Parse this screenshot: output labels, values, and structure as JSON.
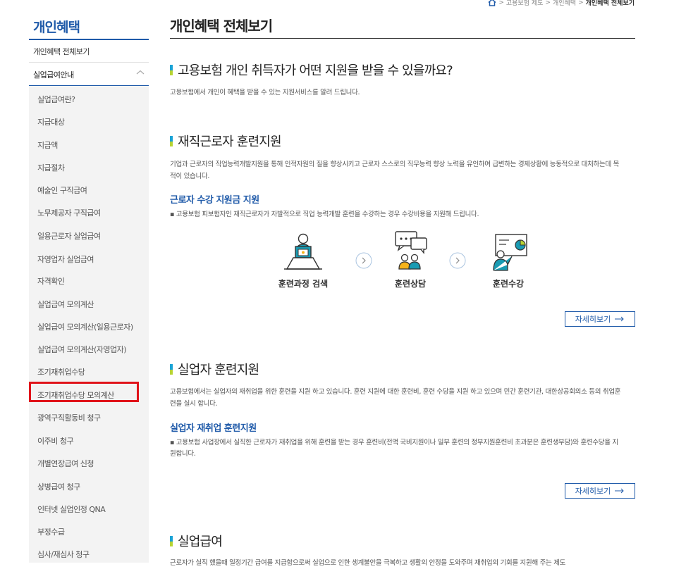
{
  "breadcrumb": {
    "items": [
      "고용보험 제도",
      "개인혜택"
    ],
    "current": "개인혜택 전체보기"
  },
  "sidebar": {
    "title": "개인혜택",
    "overview": "개인혜택 전체보기",
    "active_section": "실업급여안내",
    "items": [
      "실업급여란?",
      "지급대상",
      "지급액",
      "지급절차",
      "예술인 구직급여",
      "노무제공자 구직급여",
      "일용근로자 실업급여",
      "자영업자 실업급여",
      "자격확인",
      "실업급여 모의계산",
      "실업급여 모의계산(일용근로자)",
      "실업급여 모의계산(자영업자)",
      "조기재취업수당",
      "조기재취업수당 모의계산",
      "광역구직활동비 청구",
      "이주비 청구",
      "개별연장급여 신청",
      "상병급여 청구",
      "인터넷 실업인정 QNA",
      "부정수급",
      "심사/재심사 청구"
    ],
    "highlighted_item": "조기재취업수당 모의계산"
  },
  "main": {
    "page_title": "개인혜택 전체보기",
    "intro": {
      "heading": "고용보험 개인 취득자가 어떤 지원을 받을 수 있을까요?",
      "desc": "고용보험에서 개인이 혜택을 받을 수 있는 지원서비스를 알려 드립니다."
    },
    "section1": {
      "heading": "재직근로자 훈련지원",
      "desc": "기업과 근로자의 직업능력개발지원을 통해 인적자원의 질을 향상시키고 근로자 스스로의 직무능력 향상 노력을 유인하여 급변하는 경제상황에 능동적으로 대처하는데 목적이 있습니다.",
      "sub_heading": "근로자 수강 지원금 지원",
      "bullet": "▪ 고용보험 피보험자인 재직근로자가 자발적으로 직업 능력개발 훈련을 수강하는 경우 수강비용을 지원해 드립니다.",
      "steps": [
        "훈련과정 검색",
        "훈련상담",
        "훈련수강"
      ],
      "more": "자세히보기"
    },
    "section2": {
      "heading": "실업자 훈련지원",
      "desc": "고용보험에서는 실업자의 재취업을 위한 훈련을 지원 하고 있습니다. 훈련 지원에 대한 훈련비, 훈련 수당을 지원 하고 있으며 민간 훈련기관, 대한상공회의소 등의 취업훈련을 실시 합니다.",
      "sub_heading": "실업자 재취업 훈련지원",
      "bullet": "▪ 고용보험 사업장에서 실직한 근로자가 재취업을 위해 훈련을 받는 경우 훈련비(전액 국비지원이나 일부 훈련의 정부지원훈련비 초과분은 훈련생부담)와 훈련수당을 지원합니다.",
      "more": "자세히보기"
    },
    "section3": {
      "heading": "실업급여",
      "desc": "근로자가 실직 했을때 일정기간 급여를 지급함으로써 실업으로 인한 생계불안을 극복하고 생활의 안정을 도와주며 재취업의 기회를 지원해 주는 제도"
    }
  },
  "colors": {
    "brand_blue": "#1f5aa9",
    "highlight_red": "#e0131a",
    "icon_teal": "#1a9bb3",
    "icon_yellow": "#f6b31b"
  },
  "icons": [
    "home-icon",
    "chevron-up-icon",
    "arrow-right-icon",
    "search-training-icon",
    "consult-icon",
    "lecture-icon"
  ]
}
